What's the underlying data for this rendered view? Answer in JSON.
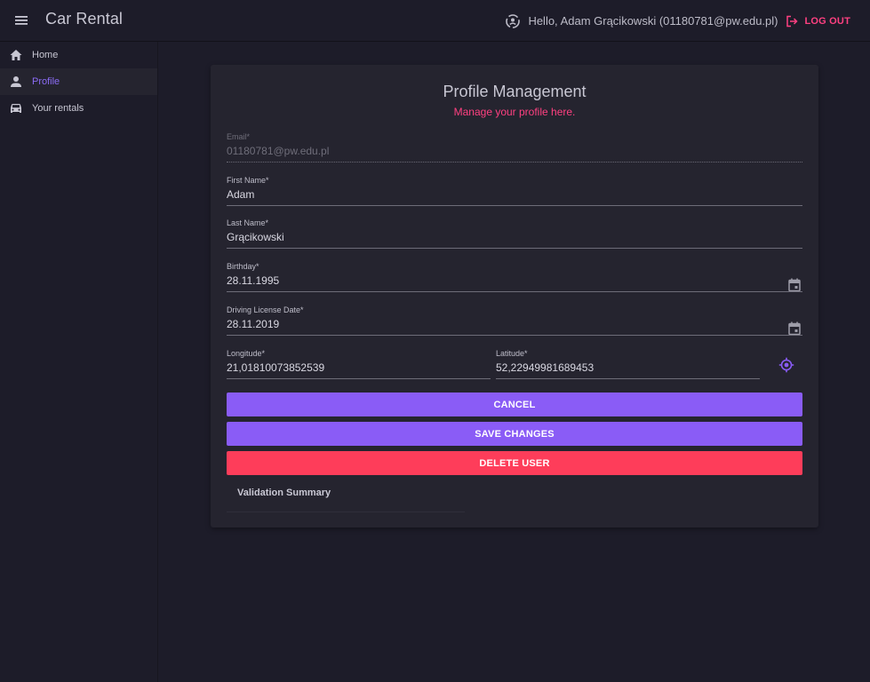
{
  "app": {
    "title": "Car Rental",
    "greeting": "Hello, Adam Grącikowski (01180781@pw.edu.pl)",
    "logout_label": "LOG OUT"
  },
  "sidebar": {
    "items": [
      {
        "label": "Home",
        "icon": "home-icon",
        "active": false
      },
      {
        "label": "Profile",
        "icon": "person-icon",
        "active": true
      },
      {
        "label": "Your rentals",
        "icon": "car-icon",
        "active": false
      }
    ]
  },
  "form": {
    "title": "Profile Management",
    "subtitle": "Manage your profile here.",
    "email": {
      "label": "Email*",
      "value": "01180781@pw.edu.pl",
      "disabled": true
    },
    "first_name": {
      "label": "First Name*",
      "value": "Adam"
    },
    "last_name": {
      "label": "Last Name*",
      "value": "Grącikowski"
    },
    "birthday": {
      "label": "Birthday*",
      "value": "28.11.1995"
    },
    "license_date": {
      "label": "Driving License Date*",
      "value": "28.11.2019"
    },
    "longitude": {
      "label": "Longitude*",
      "value": "21,01810073852539"
    },
    "latitude": {
      "label": "Latitude*",
      "value": "52,22949981689453"
    },
    "buttons": {
      "cancel": "CANCEL",
      "save": "SAVE CHANGES",
      "delete": "DELETE USER"
    },
    "validation_summary": "Validation Summary"
  },
  "colors": {
    "background": "#1d1c29",
    "card": "#25242f",
    "accent": "#8a5cf6",
    "danger": "#fe3d5a",
    "pink": "#ff4081"
  }
}
